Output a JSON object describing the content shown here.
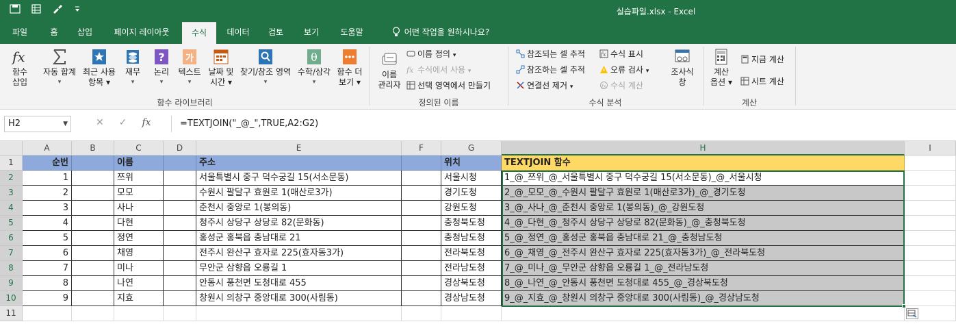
{
  "titlebar": {
    "title": "실습파일.xlsx  -  Excel",
    "qat_items": [
      "save-icon",
      "table-icon",
      "brush-icon",
      "customize-icon"
    ]
  },
  "tabs": [
    {
      "label": "파일"
    },
    {
      "label": "홈"
    },
    {
      "label": "삽입"
    },
    {
      "label": "페이지 레이아웃"
    },
    {
      "label": "수식",
      "active": true
    },
    {
      "label": "데이터"
    },
    {
      "label": "검토"
    },
    {
      "label": "보기"
    },
    {
      "label": "도움말"
    },
    {
      "label": "어떤 작업을 원하시나요?"
    }
  ],
  "ribbon": {
    "library": {
      "group_label": "함수 라이브러리",
      "insert_fn": [
        "함수",
        "삽입"
      ],
      "autosum": "자동 합계",
      "recent": [
        "최근 사용",
        "항목"
      ],
      "finance": "재무",
      "logical": "논리",
      "text": "텍스트",
      "datetime": [
        "날짜 및",
        "시간"
      ],
      "lookup": "찾기/참조 영역",
      "math": "수학/삼각",
      "more": [
        "함수 더",
        "보기"
      ]
    },
    "names": {
      "group_label": "정의된 이름",
      "manager": [
        "이름",
        "관리자"
      ],
      "define": "이름 정의",
      "use": "수식에서 사용",
      "create": "선택 영역에서 만들기"
    },
    "audit": {
      "group_label": "수식 분석",
      "precedents": "참조되는 셀 추적",
      "dependents": "참조하는 셀 추적",
      "remove": "연결선 제거",
      "show": "수식 표시",
      "errors": "오류 검사",
      "evaluate": "수식 계산",
      "watch": [
        "조사식",
        "창"
      ]
    },
    "calc": {
      "group_label": "계산",
      "options": [
        "계산",
        "옵션"
      ],
      "now": "지금 계산",
      "sheet": "시트 계산"
    }
  },
  "formula_bar": {
    "name_box": "H2",
    "formula": "=TEXTJOIN(\"_@_\",TRUE,A2:G2)"
  },
  "sheet": {
    "columns": [
      "A",
      "B",
      "C",
      "D",
      "E",
      "F",
      "G",
      "H",
      "I"
    ],
    "rows": [
      "1",
      "2",
      "3",
      "4",
      "5",
      "6",
      "7",
      "8",
      "9",
      "10",
      "11"
    ],
    "header": {
      "A": "순번",
      "C": "이름",
      "E": "주소",
      "G": "위치",
      "H": "TEXTJOIN 함수"
    },
    "data": [
      {
        "A": "1",
        "C": "쯔위",
        "E": "서울특별시 중구 덕수궁길 15(서소문동)",
        "G": "서울시청",
        "H": "1_@_쯔위_@_서울특별시 중구 덕수궁길 15(서소문동)_@_서울시청"
      },
      {
        "A": "2",
        "C": "모모",
        "E": "수원시 팔달구 효원로 1(매산로3가)",
        "G": "경기도청",
        "H": "2_@_모모_@_수원시 팔달구 효원로 1(매산로3가)_@_경기도청"
      },
      {
        "A": "3",
        "C": "사나",
        "E": "춘천시 중앙로 1(봉의동)",
        "G": "강원도청",
        "H": "3_@_사나_@_춘천시 중앙로 1(봉의동)_@_강원도청"
      },
      {
        "A": "4",
        "C": "다현",
        "E": "청주시 상당구 상당로 82(문화동)",
        "G": "충청북도청",
        "H": "4_@_다현_@_청주시 상당구 상당로 82(문화동)_@_충청북도청"
      },
      {
        "A": "5",
        "C": "정연",
        "E": "홍성군 홍북읍 충남대로 21",
        "G": "충청남도청",
        "H": "5_@_정연_@_홍성군 홍북읍 충남대로 21_@_충청남도청"
      },
      {
        "A": "6",
        "C": "채영",
        "E": "전주시 완산구 효자로 225(효자동3가)",
        "G": "전라북도청",
        "H": "6_@_채영_@_전주시 완산구 효자로 225(효자동3가)_@_전라북도청"
      },
      {
        "A": "7",
        "C": "미나",
        "E": "무안군 삼향읍 오룡길 1",
        "G": "전라남도청",
        "H": "7_@_미나_@_무안군 삼향읍 오룡길 1_@_전라남도청"
      },
      {
        "A": "8",
        "C": "나연",
        "E": "안동시 풍천면 도청대로 455",
        "G": "경상북도청",
        "H": "8_@_나연_@_안동시 풍천면 도청대로 455_@_경상북도청"
      },
      {
        "A": "9",
        "C": "지효",
        "E": "창원시 의창구 중앙대로 300(사림동)",
        "G": "경상남도청",
        "H": "9_@_지효_@_창원시 의창구 중앙대로 300(사림동)_@_경상남도청"
      }
    ]
  },
  "colors": {
    "excel_green": "#217346",
    "header_blue": "#8ea9db",
    "header_yellow": "#ffd966",
    "selection_grey": "#c8c8c8"
  }
}
